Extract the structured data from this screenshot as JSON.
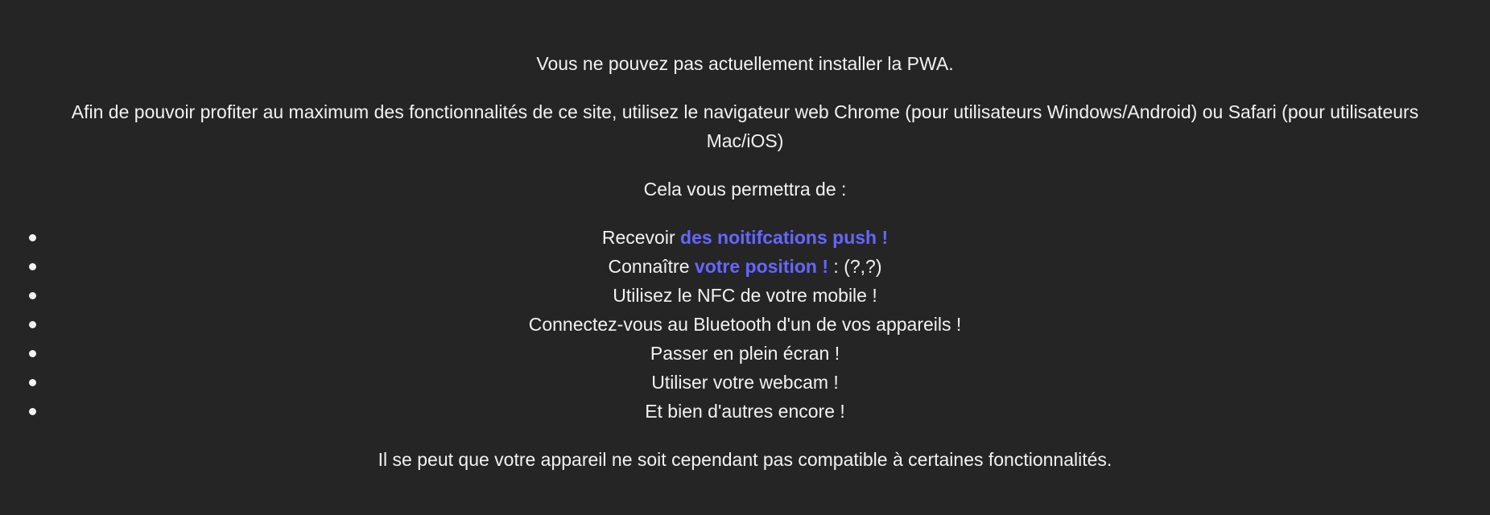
{
  "intro": "Vous ne pouvez pas actuellement installer la PWA.",
  "advice": "Afin de pouvoir profiter au maximum des fonctionnalités de ce site, utilisez le navigateur web Chrome (pour utilisateurs Windows/Android) ou Safari (pour utilisateurs Mac/iOS)",
  "lead": "Cela vous permettra de :",
  "features": [
    {
      "prefix": "Recevoir ",
      "highlight": "des noitifcations push !",
      "suffix": ""
    },
    {
      "prefix": "Connaître ",
      "highlight": "votre position !",
      "suffix": " : (?,?)"
    },
    {
      "prefix": "Utilisez le NFC de votre mobile !",
      "highlight": "",
      "suffix": ""
    },
    {
      "prefix": "Connectez-vous au Bluetooth d'un de vos appareils !",
      "highlight": "",
      "suffix": ""
    },
    {
      "prefix": "Passer en plein écran !",
      "highlight": "",
      "suffix": ""
    },
    {
      "prefix": "Utiliser votre webcam !",
      "highlight": "",
      "suffix": ""
    },
    {
      "prefix": "Et bien d'autres encore !",
      "highlight": "",
      "suffix": ""
    }
  ],
  "footer": "Il se peut que votre appareil ne soit cependant pas compatible à certaines fonctionnalités.",
  "colors": {
    "background": "#252526",
    "text": "#f2f2f2",
    "highlight": "#6666ff"
  }
}
